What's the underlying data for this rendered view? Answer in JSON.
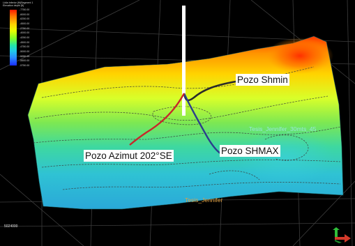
{
  "legend": {
    "title": "Lidia Inferior (fit)Segment 1",
    "subtitle": "Elevation depth [ft]",
    "ticks": [
      "-7750.00",
      "-6000.00",
      "-6250.00",
      "-4500.00",
      "-2750.00",
      "-4000.00",
      "-4250.00",
      "-4500.00",
      "-4750.00",
      "-5000.00",
      "-5250.00",
      "-5500.00",
      "-5750.00"
    ]
  },
  "callouts": {
    "shmin": "Pozo Shmin",
    "shmax": "Pozo SHMAX",
    "azimut": "Pozo Azimut 202°SE"
  },
  "surface_labels": {
    "tesis1": "Tesis_Jennifer_30mts_45",
    "tesis2": "Tesis_Jennifer"
  },
  "scale_readout": "5024000",
  "colors": {
    "background": "#000000",
    "well_shmin": "#2a2a2a",
    "well_shmax": "#2b3f8c",
    "well_azimut": "#c8262a",
    "vertical_well": "#ffffff",
    "grid": "#3d3d3d"
  },
  "icons": {
    "compass": "axis-arrows-icon"
  }
}
